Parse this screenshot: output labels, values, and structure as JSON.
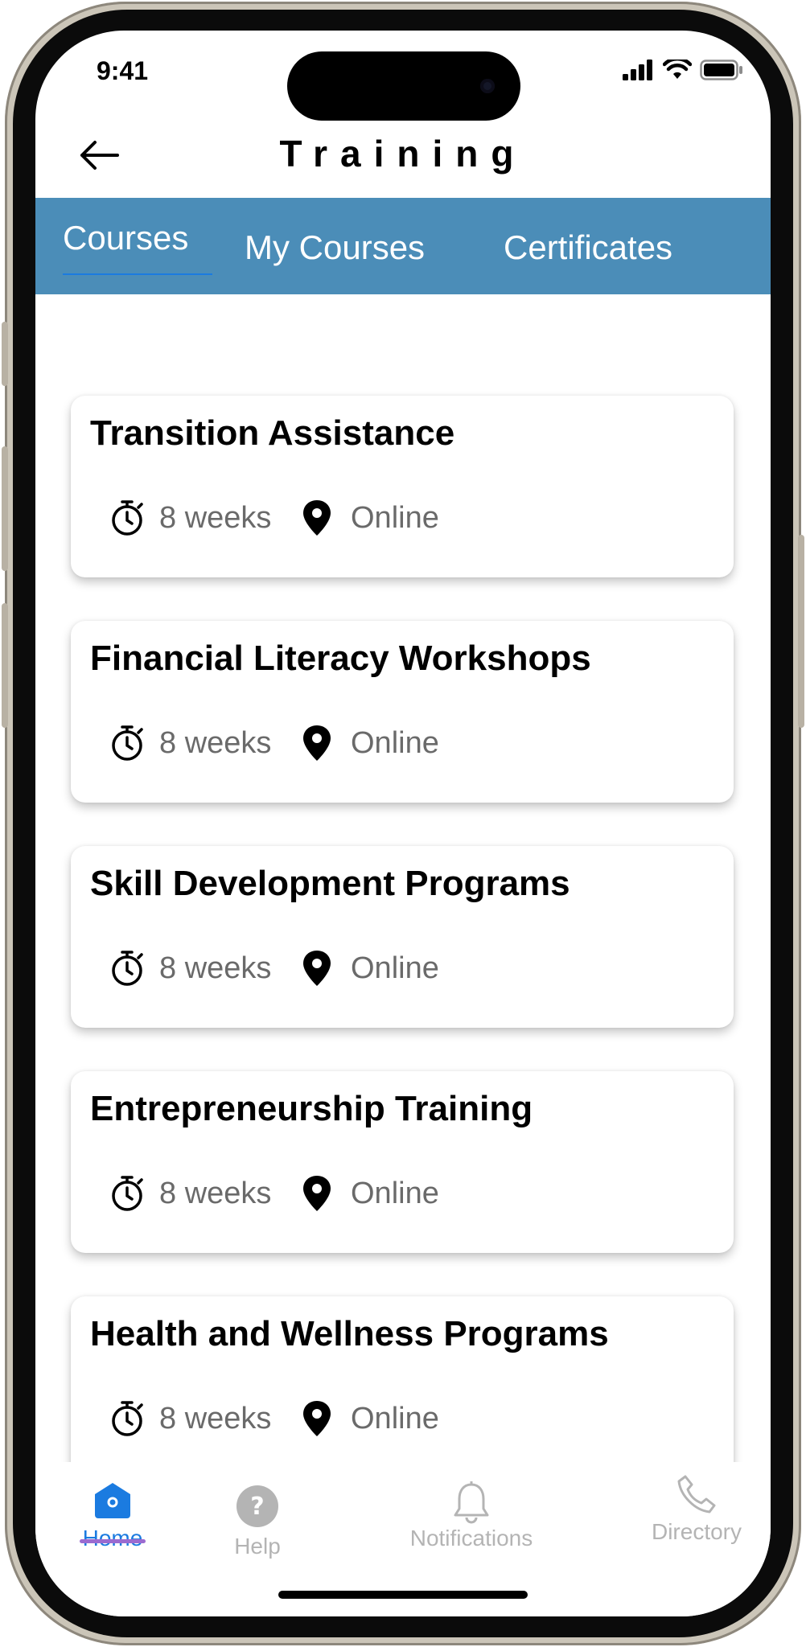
{
  "status_bar": {
    "time": "9:41"
  },
  "header": {
    "title": "Training"
  },
  "tabs": [
    {
      "label": "Courses",
      "active": true
    },
    {
      "label": "My Courses",
      "active": false
    },
    {
      "label": "Certificates",
      "active": false
    }
  ],
  "courses": [
    {
      "title": "Transition Assistance",
      "duration": "8 weeks",
      "location": "Online"
    },
    {
      "title": "Financial Literacy Workshops",
      "duration": "8 weeks",
      "location": "Online"
    },
    {
      "title": "Skill Development Programs",
      "duration": "8 weeks",
      "location": "Online"
    },
    {
      "title": "Entrepreneurship Training",
      "duration": "8 weeks",
      "location": "Online"
    },
    {
      "title": "Health and Wellness Programs",
      "duration": "8 weeks",
      "location": "Online"
    }
  ],
  "bottom_nav": [
    {
      "label": "Home",
      "icon": "home-icon",
      "active": true
    },
    {
      "label": "Help",
      "icon": "help-icon",
      "active": false
    },
    {
      "label": "Notifications",
      "icon": "bell-icon",
      "active": false
    },
    {
      "label": "Directory",
      "icon": "phone-icon",
      "active": false
    }
  ],
  "colors": {
    "tab_bar": "#4b8db8",
    "active_nav": "#1b7be0",
    "inactive_nav": "#b4b4b4",
    "nav_indicator": "#9b6bd0"
  }
}
